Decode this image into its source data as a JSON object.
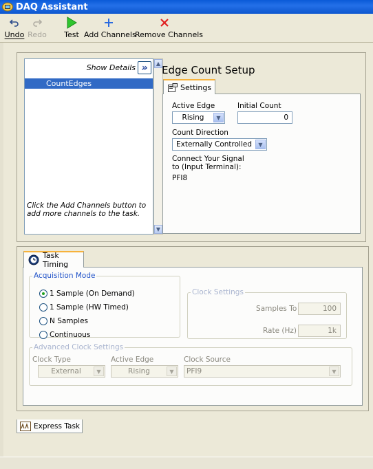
{
  "window": {
    "title": "DAQ Assistant"
  },
  "toolbar": {
    "undo": "Undo",
    "redo": "Redo",
    "test": "Test",
    "add_channels": "Add Channels",
    "remove_channels": "Remove Channels"
  },
  "channels": {
    "show_details": "Show Details",
    "items": [
      "CountEdges"
    ],
    "hint": "Click the Add Channels button to add more channels to the task."
  },
  "setup": {
    "title": "Edge Count Setup",
    "tab": "Settings",
    "active_edge_label": "Active Edge",
    "active_edge_value": "Rising",
    "initial_count_label": "Initial Count",
    "initial_count_value": "0",
    "count_direction_label": "Count Direction",
    "count_direction_value": "Externally Controlled",
    "connect_line1": "Connect Your Signal",
    "connect_line2": "to (Input Terminal):",
    "terminal": "PFI8"
  },
  "timing": {
    "tab": "Task Timing",
    "acq_mode_legend": "Acquisition Mode",
    "modes": [
      "1 Sample (On Demand)",
      "1 Sample (HW Timed)",
      "N Samples",
      "Continuous"
    ],
    "selected_mode": "1 Sample (On Demand)",
    "clock_settings_legend": "Clock Settings",
    "samples_to_read_label": "Samples To Read",
    "samples_to_read_value": "100",
    "rate_label": "Rate (Hz)",
    "rate_value": "1k",
    "adv_legend": "Advanced Clock Settings",
    "clock_type_label": "Clock Type",
    "clock_type_value": "External",
    "active_edge_label": "Active Edge",
    "active_edge_value": "Rising",
    "clock_source_label": "Clock Source",
    "clock_source_value": "PFI9"
  },
  "bottom_tabs": {
    "express_task": "Express Task"
  },
  "colors": {
    "title_bar": "#0a5ad8",
    "selection": "#316ac5",
    "group_legend": "#2052c8",
    "tab_highlight": "#f7b23b"
  }
}
